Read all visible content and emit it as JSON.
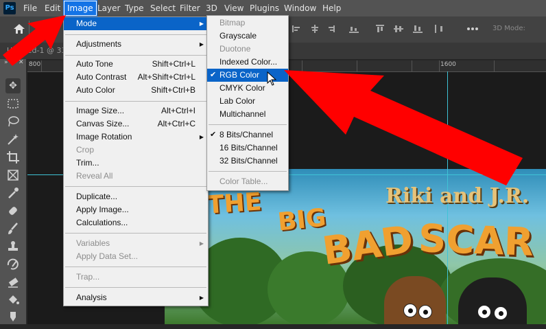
{
  "app": {
    "logo": "Ps"
  },
  "menubar": {
    "items": [
      "File",
      "Edit",
      "Image",
      "Layer",
      "Type",
      "Select",
      "Filter",
      "3D",
      "View",
      "Plugins",
      "Window",
      "Help"
    ],
    "active": "Image"
  },
  "options_bar": {
    "mode_label": "3D Mode:"
  },
  "document": {
    "tab_title": "Untitled-1 @ 33"
  },
  "ruler": {
    "labels": [
      "800",
      "1600"
    ]
  },
  "image_menu": {
    "items": [
      {
        "label": "Mode",
        "submenu": true,
        "highlighted": true
      },
      {
        "label": "Adjustments",
        "submenu": true
      },
      {
        "label": "Auto Tone",
        "shortcut": "Shift+Ctrl+L"
      },
      {
        "label": "Auto Contrast",
        "shortcut": "Alt+Shift+Ctrl+L"
      },
      {
        "label": "Auto Color",
        "shortcut": "Shift+Ctrl+B"
      },
      {
        "label": "Image Size...",
        "shortcut": "Alt+Ctrl+I"
      },
      {
        "label": "Canvas Size...",
        "shortcut": "Alt+Ctrl+C"
      },
      {
        "label": "Image Rotation",
        "submenu": true
      },
      {
        "label": "Crop",
        "disabled": true
      },
      {
        "label": "Trim..."
      },
      {
        "label": "Reveal All",
        "disabled": true
      },
      {
        "label": "Duplicate..."
      },
      {
        "label": "Apply Image..."
      },
      {
        "label": "Calculations..."
      },
      {
        "label": "Variables",
        "submenu": true,
        "disabled": true
      },
      {
        "label": "Apply Data Set...",
        "disabled": true
      },
      {
        "label": "Trap...",
        "disabled": true
      },
      {
        "label": "Analysis",
        "submenu": true
      }
    ]
  },
  "mode_menu": {
    "items": [
      {
        "label": "Bitmap",
        "disabled": true
      },
      {
        "label": "Grayscale"
      },
      {
        "label": "Duotone",
        "disabled": true
      },
      {
        "label": "Indexed Color..."
      },
      {
        "label": "RGB Color",
        "checked": true,
        "highlighted": true
      },
      {
        "label": "CMYK Color"
      },
      {
        "label": "Lab Color"
      },
      {
        "label": "Multichannel"
      },
      {
        "label": "8 Bits/Channel",
        "checked": true
      },
      {
        "label": "16 Bits/Channel"
      },
      {
        "label": "32 Bits/Channel"
      },
      {
        "label": "Color Table...",
        "disabled": true
      }
    ]
  },
  "artwork": {
    "author": "Riki and J.R.",
    "title_words": [
      "THE",
      "BIG",
      "BAD",
      "SCAR"
    ]
  },
  "colors": {
    "menu_highlight": "#0a64c8",
    "active_menu": "#1473e6",
    "guide": "#3fc3d6",
    "arrow": "#ff0000",
    "title_orange": "#f0a030"
  },
  "icons": {
    "home": "home-icon",
    "move": "move-tool-icon",
    "marquee": "marquee-tool-icon",
    "lasso": "lasso-tool-icon",
    "magic_wand": "magic-wand-icon",
    "crop": "crop-tool-icon",
    "frame": "frame-tool-icon",
    "eyedropper": "eyedropper-icon",
    "healing": "healing-brush-icon",
    "brush": "brush-tool-icon",
    "stamp": "clone-stamp-icon",
    "history_brush": "history-brush-icon",
    "eraser": "eraser-icon",
    "bucket": "paint-bucket-icon",
    "smudge": "smudge-icon",
    "more": "more-options-icon"
  }
}
